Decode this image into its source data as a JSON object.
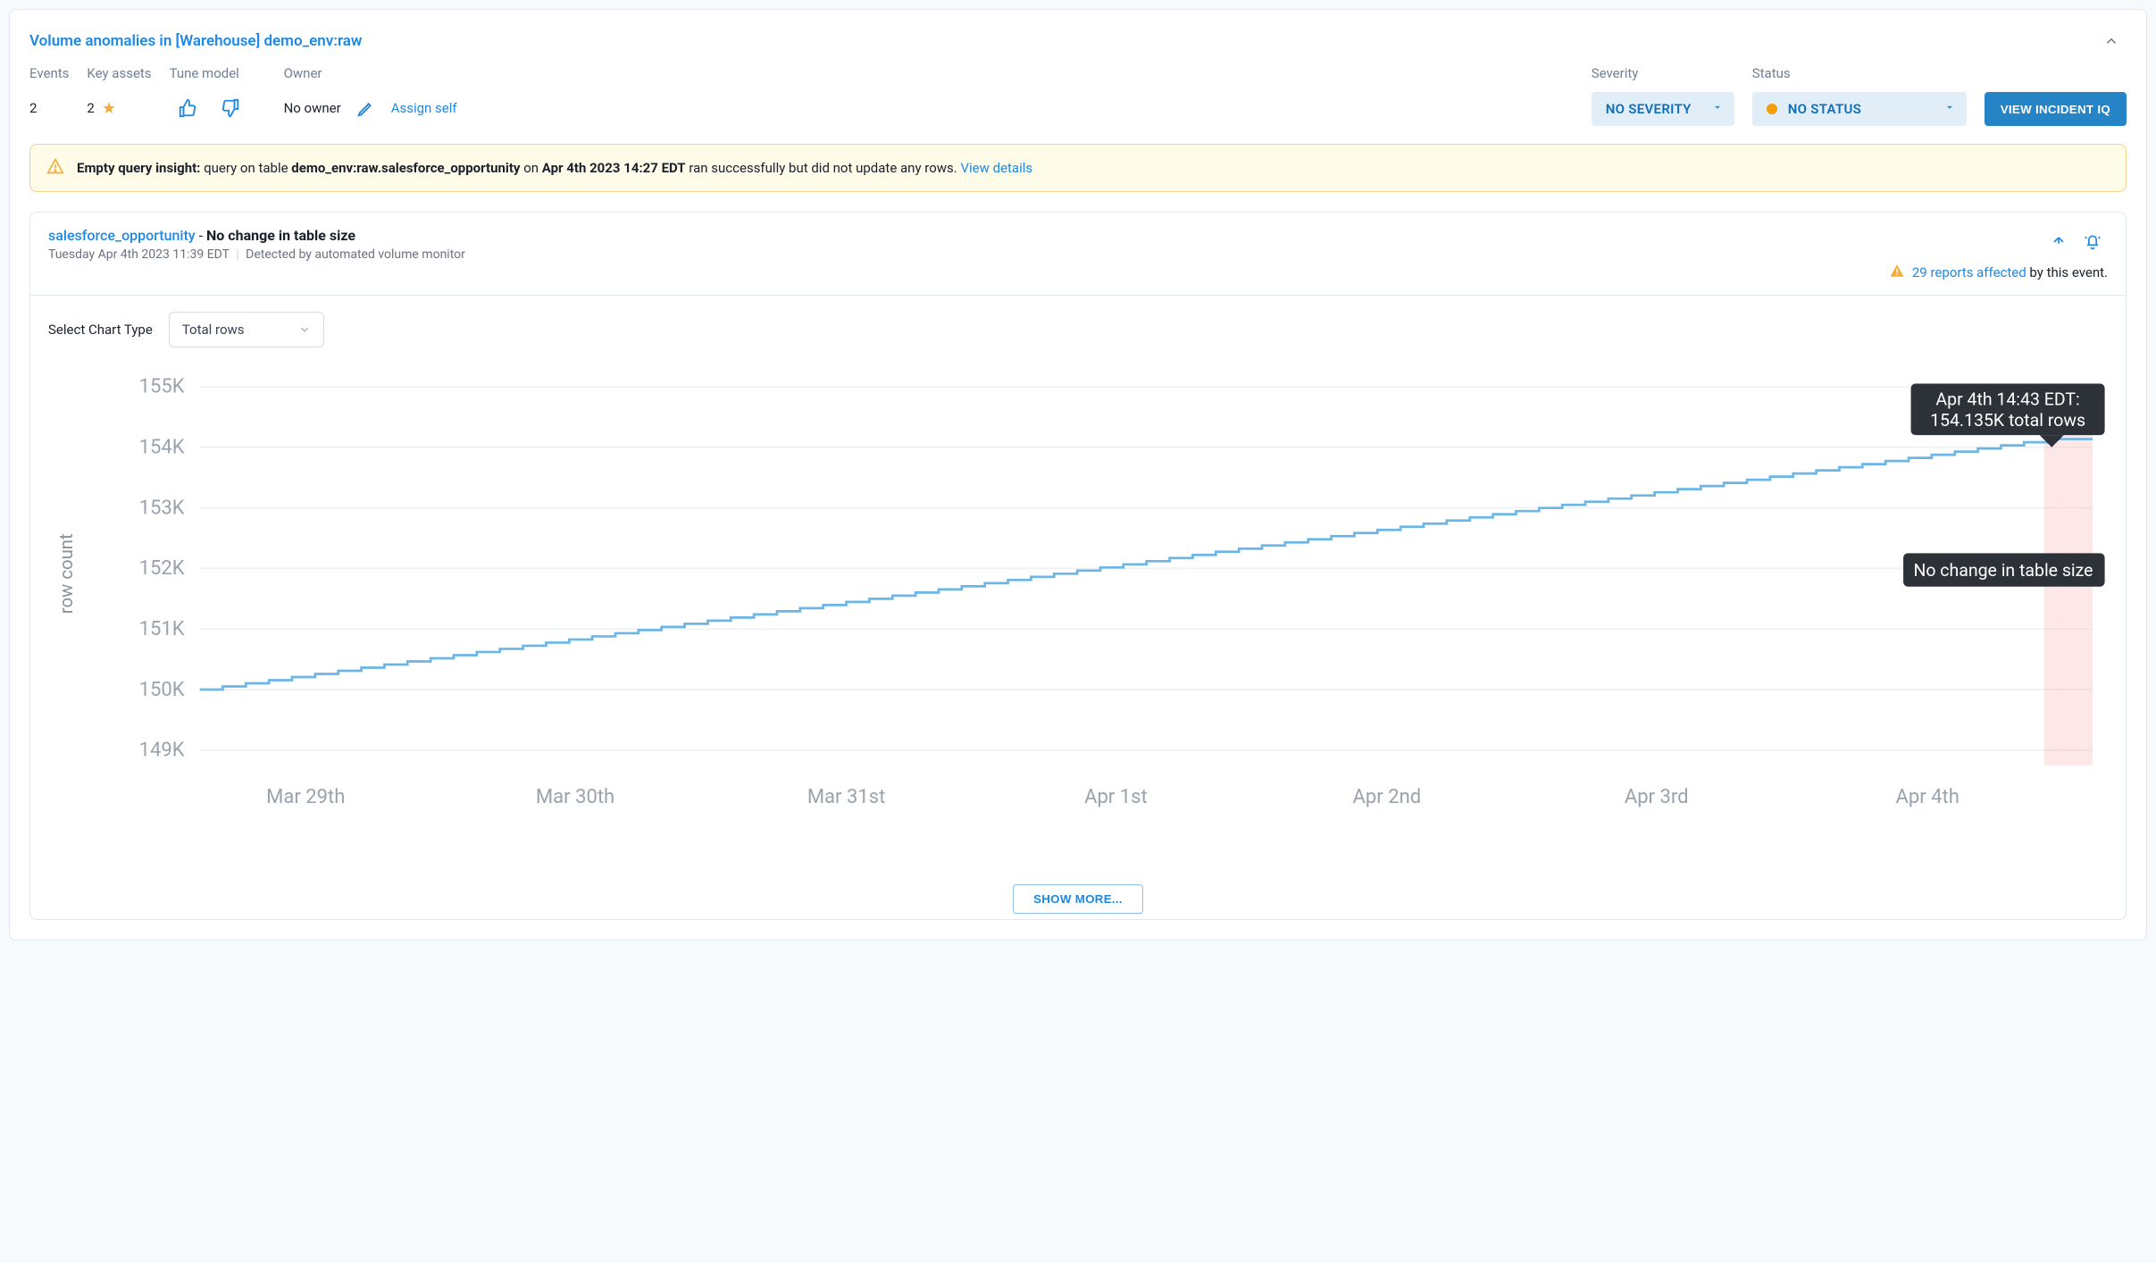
{
  "title": "Volume anomalies in [Warehouse] demo_env:raw",
  "meta": {
    "events_label": "Events",
    "events_value": "2",
    "key_assets_label": "Key assets",
    "key_assets_value": "2",
    "tune_label": "Tune model",
    "owner_label": "Owner",
    "owner_value": "No owner",
    "assign_self": "Assign self",
    "severity_label": "Severity",
    "severity_value": "NO SEVERITY",
    "status_label": "Status",
    "status_value": "NO STATUS",
    "view_iq": "VIEW INCIDENT IQ"
  },
  "insight": {
    "prefix": "Empty query insight:",
    "text1": " query on table ",
    "table": "demo_env:raw.salesforce_opportunity",
    "text2": " on ",
    "time": "Apr 4th 2023 14:27 EDT",
    "text3": " ran successfully but did not update any rows. ",
    "link": "View details"
  },
  "event": {
    "asset": "salesforce_opportunity",
    "dash": " - ",
    "status": "No change in table size",
    "timestamp": "Tuesday Apr 4th 2023 11:39 EDT",
    "detected_by": "Detected by automated volume monitor",
    "reports_count": "29 reports affected",
    "reports_suffix": " by this event."
  },
  "chart_controls": {
    "label": "Select Chart Type",
    "selected": "Total rows"
  },
  "chart_data": {
    "type": "line",
    "ylabel": "row count",
    "y_ticks": [
      "149K",
      "150K",
      "151K",
      "152K",
      "153K",
      "154K",
      "155K"
    ],
    "x_ticks": [
      "Mar 29th",
      "Mar 30th",
      "Mar 31st",
      "Apr 1st",
      "Apr 2nd",
      "Apr 3rd",
      "Apr 4th"
    ],
    "ylim": [
      149,
      155
    ],
    "x_range_days": [
      "Mar 29",
      "Apr 5"
    ],
    "series": [
      {
        "name": "total_rows",
        "approx_start": 150.0,
        "approx_end": 154.135,
        "shape": "step-increasing then flat at end"
      }
    ],
    "tooltip1": {
      "line1": "Apr 4th 14:43 EDT:",
      "line2": "154.135K total rows"
    },
    "tooltip2": {
      "text": "No change in table size"
    },
    "anomaly_region": "rightmost ~3% of x-axis highlighted pink"
  },
  "show_more": "SHOW MORE..."
}
